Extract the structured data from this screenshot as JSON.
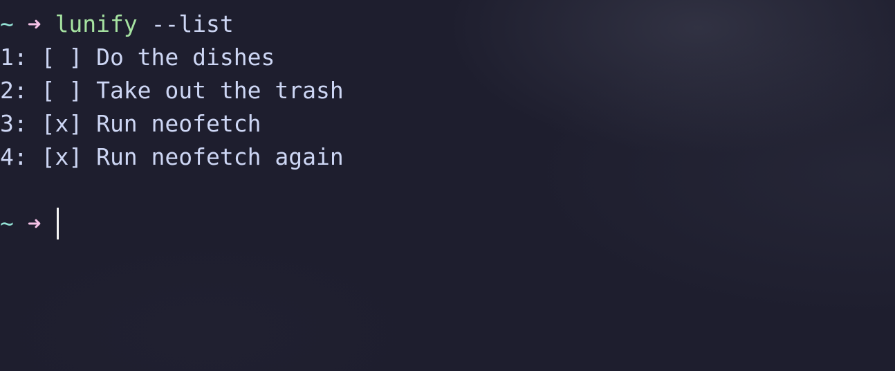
{
  "prompt": {
    "tilde": "~",
    "arrow": "➜"
  },
  "command": {
    "name": "lunify",
    "args": " --list"
  },
  "todos": [
    {
      "text": "1: [ ] Do the dishes"
    },
    {
      "text": "2: [ ] Take out the trash"
    },
    {
      "text": "3: [x] Run neofetch"
    },
    {
      "text": "4: [x] Run neofetch again"
    }
  ],
  "colors": {
    "background": "#1e1e2e",
    "foreground": "#cdd6f4",
    "tilde": "#94e2d5",
    "arrow": "#f5c2e7",
    "command": "#a6e3a1",
    "cursor": "#f5f5f5"
  }
}
